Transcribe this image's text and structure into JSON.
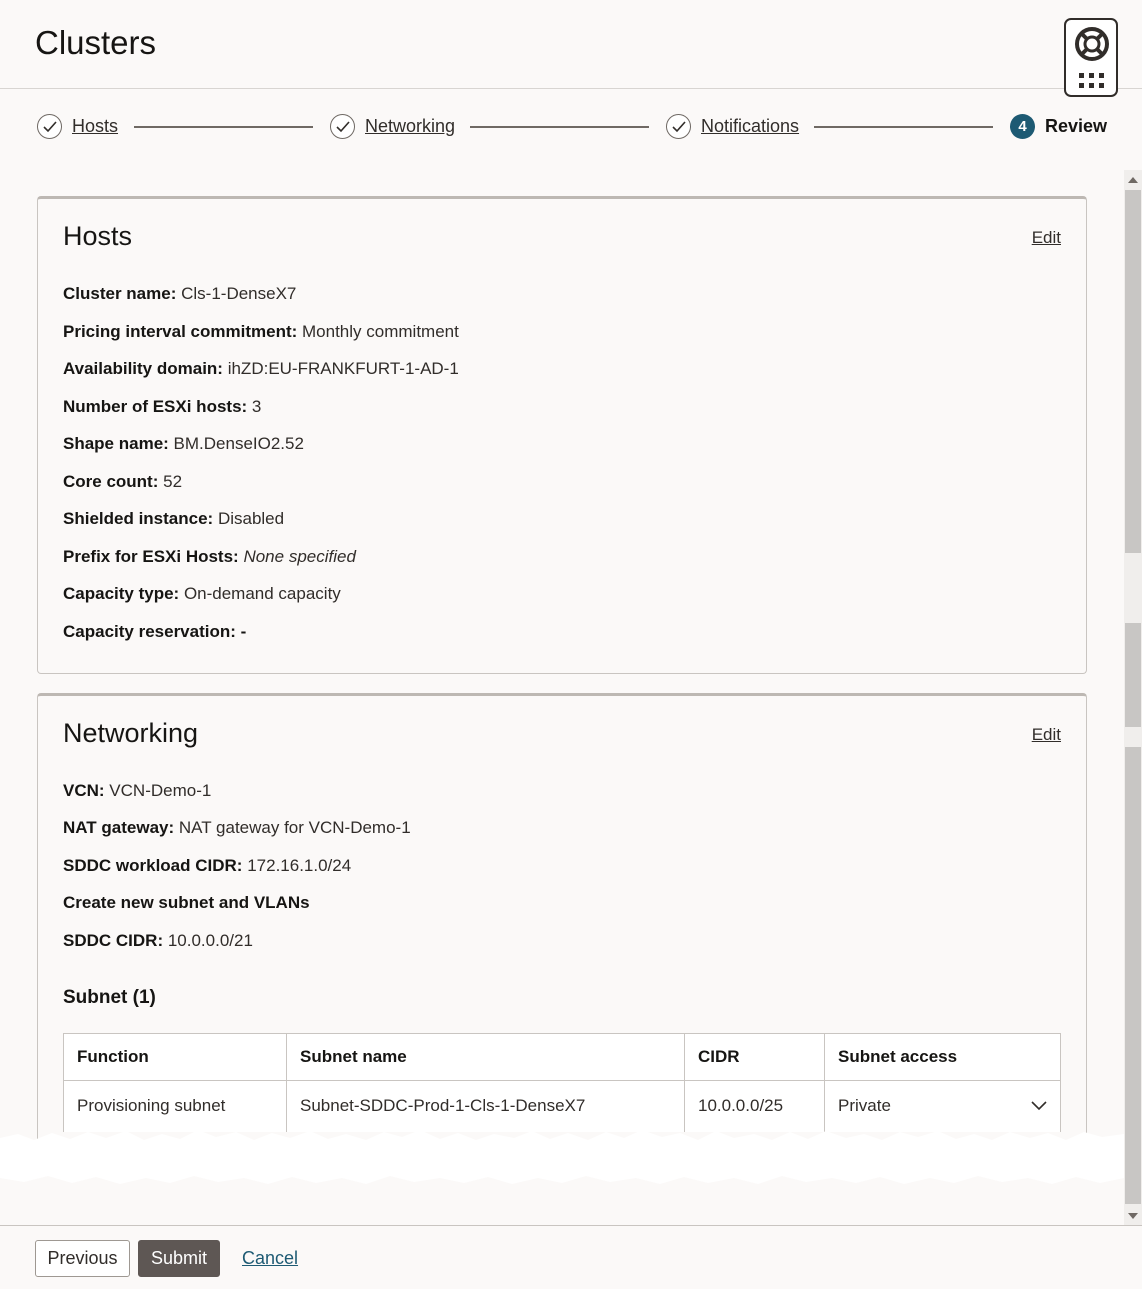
{
  "header": {
    "title": "Clusters"
  },
  "stepper": {
    "steps": [
      {
        "label": "Hosts",
        "state": "complete"
      },
      {
        "label": "Networking",
        "state": "complete"
      },
      {
        "label": "Notifications",
        "state": "complete"
      },
      {
        "label": "Review",
        "number": "4",
        "state": "current"
      }
    ]
  },
  "hosts_card": {
    "title": "Hosts",
    "edit_label": "Edit",
    "fields": [
      {
        "label": "Cluster name:",
        "value": "Cls-1-DenseX7"
      },
      {
        "label": "Pricing interval commitment:",
        "value": "Monthly commitment"
      },
      {
        "label": "Availability domain:",
        "value": "ihZD:EU-FRANKFURT-1-AD-1"
      },
      {
        "label": "Number of ESXi hosts:",
        "value": "3"
      },
      {
        "label": "Shape name:",
        "value": "BM.DenseIO2.52"
      },
      {
        "label": "Core count:",
        "value": "52"
      },
      {
        "label": "Shielded instance:",
        "value": "Disabled"
      },
      {
        "label": "Prefix for ESXi Hosts:",
        "value": "None specified"
      },
      {
        "label": "Capacity type:",
        "value": "On-demand capacity"
      },
      {
        "label": "Capacity reservation:",
        "value": "-"
      }
    ]
  },
  "networking_card": {
    "title": "Networking",
    "edit_label": "Edit",
    "fields": [
      {
        "label": "VCN:",
        "value": "VCN-Demo-1"
      },
      {
        "label": "NAT gateway:",
        "value": "NAT gateway for VCN-Demo-1"
      },
      {
        "label": "SDDC workload CIDR:",
        "value": "172.16.1.0/24"
      },
      {
        "label": "Create new subnet and VLANs",
        "value": ""
      },
      {
        "label": "SDDC CIDR:",
        "value": "10.0.0.0/21"
      }
    ],
    "subnet_heading": "Subnet (1)",
    "subnet_table": {
      "columns": [
        "Function",
        "Subnet name",
        "CIDR",
        "Subnet access"
      ],
      "rows": [
        [
          "Provisioning subnet",
          "Subnet-SDDC-Prod-1-Cls-1-DenseX7",
          "10.0.0.0/25",
          "Private"
        ]
      ]
    }
  },
  "footer": {
    "previous_label": "Previous",
    "submit_label": "Submit",
    "cancel_label": "Cancel"
  },
  "colors": {
    "step_current": "#1d5a73",
    "submit_bg": "#5e5754",
    "link": "#1d5a73"
  }
}
